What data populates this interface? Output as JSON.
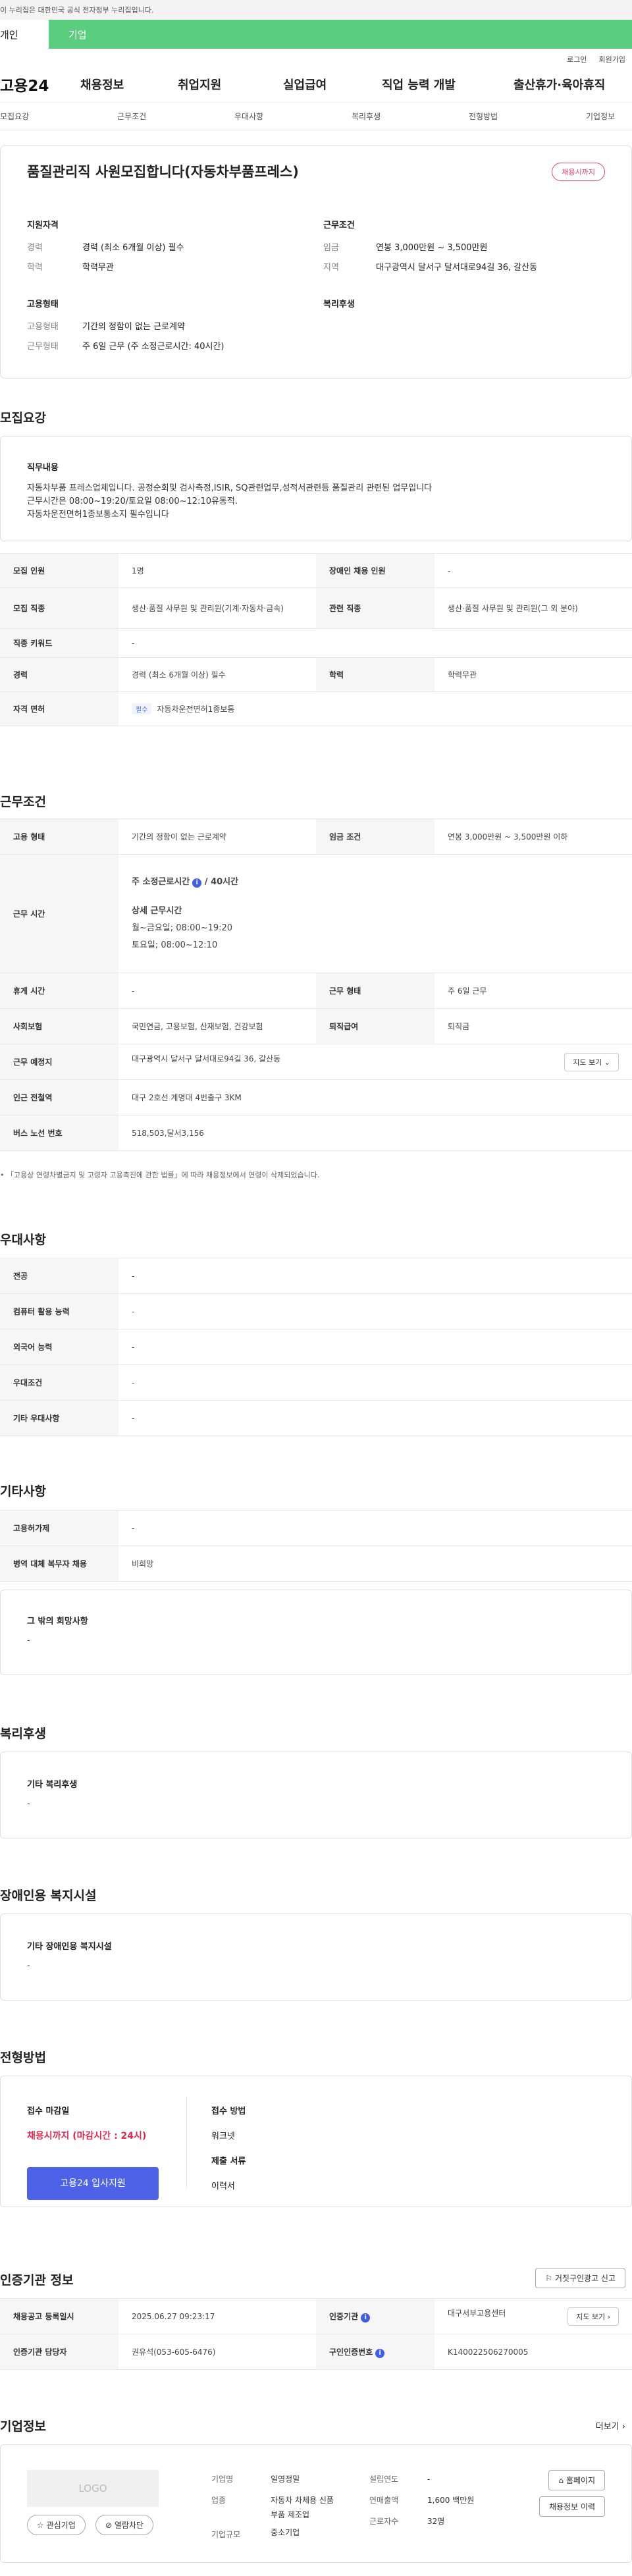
{
  "gov_bar": "이 누리집은 대한민국 공식 전자정부 누리집입니다.",
  "top_tabs": {
    "person": "개인",
    "corp": "기업"
  },
  "util_links": [
    "로그인",
    "회원가입"
  ],
  "logo": "고용24",
  "nav": [
    "채용정보",
    "취업지원",
    "실업급여",
    "직업 능력 개발",
    "출산휴가·육아휴직"
  ],
  "sub_nav": [
    "모집요강",
    "근무조건",
    "우대사항",
    "복리후생",
    "전형방법",
    "기업정보"
  ],
  "job": {
    "title": "품질관리직 사원모집합니다(자동차부품프레스)",
    "badge": "채용시까지",
    "qual_title": "지원자격",
    "career_k": "경력",
    "career_v": "경력 (최소 6개월 이상) 필수",
    "edu_k": "학력",
    "edu_v": "학력무관",
    "emp_title": "고용형태",
    "emp_k": "고용형태",
    "emp_v": "기간의 정함이 없는 근로계약",
    "work_k": "근무형태",
    "work_v": "주 6일 근무 (주 소정근로시간: 40시간)",
    "cond_title": "근무조건",
    "wage_k": "임금",
    "wage_v": "연봉 3,000만원 ~ 3,500만원",
    "area_k": "지역",
    "area_v": "대구광역시 달서구 달서대로94길 36, 갈산동",
    "welfare_title": "복리후생"
  },
  "recruit": {
    "title": "모집요강",
    "duty_h": "직무내용",
    "duty_1": "자동차부품 프레스업체입니다. 공정순회및 검사측정,ISIR, SQ관련업무,성적서관련등 품질관리 관련된 업무입니다",
    "duty_2": "근무시간은 08:00~19:20/토요일 08:00~12:10유동적.",
    "duty_3": "자동차운전면허1종보통소지 필수입니다",
    "rows": {
      "count_k": "모집 인원",
      "count_v": "1명",
      "disabled_k": "장애인 채용 인원",
      "disabled_v": "-",
      "job_k": "모집 직종",
      "job_v": "생산·품질 사무원 및 관리원(기계·자동차·금속)",
      "rel_k": "관련 직종",
      "rel_v": "생산·품질 사무원 및 관리원(그 외 분야)",
      "kw_k": "직종 키워드",
      "kw_v": "-",
      "career_k": "경력",
      "career_v": "경력 (최소 6개월 이상) 필수",
      "edu_k": "학력",
      "edu_v": "학력무관",
      "lic_k": "자격 면허",
      "lic_tag": "필수",
      "lic_v": "자동차운전면허1종보통"
    }
  },
  "work": {
    "title": "근무조건",
    "type_k": "고용 형태",
    "type_v": "기간의 정함이 없는 근로계약",
    "wage_k": "임금 조건",
    "wage_v": "연봉 3,000만원 ~ 3,500만원 이하",
    "hours_k": "근무 시간",
    "hours_main": "주 소정근로시간",
    "hours_val": "40시간",
    "detail_h": "상세 근무시간",
    "detail_1": "월~금요일; 08:00~19:20",
    "detail_2": "토요일; 08:00~12:10",
    "rest_k": "휴게 시간",
    "rest_v": "-",
    "form_k": "근무 형태",
    "form_v": "주 6일 근무",
    "ins_k": "사회보험",
    "ins_v": "국민연금, 고용보험, 산재보험, 건강보험",
    "ret_k": "퇴직급여",
    "ret_v": "퇴직금",
    "place_k": "근무 예정지",
    "place_v": "대구광역시 달서구 달서대로94길 36, 갈산동",
    "map_btn": "지도 보기",
    "subway_k": "인근 전철역",
    "subway_v": "대구 2호선 계명대 4번출구 3KM",
    "bus_k": "버스 노선 번호",
    "bus_v": "518,503,달서3,156",
    "note": "「고용상 연령차별금지 및 고령자 고용촉진에 관한 법률」에 따라 채용정보에서 연령이 삭제되었습니다."
  },
  "pref": {
    "title": "우대사항",
    "major_k": "전공",
    "major_v": "-",
    "pc_k": "컴퓨터 활용 능력",
    "pc_v": "-",
    "lang_k": "외국어 능력",
    "lang_v": "-",
    "cond_k": "우대조건",
    "cond_v": "-",
    "etc_k": "기타 우대사항",
    "etc_v": "-"
  },
  "other": {
    "title": "기타사항",
    "ins_k": "고용허가제",
    "ins_v": "-",
    "mil_k": "병역 대체 복무자 채용",
    "mil_v": "비희망",
    "wish_h": "그 밖의 희망사항",
    "wish_v": "-"
  },
  "welfare": {
    "title": "복리후생",
    "h": "기타 복리후생",
    "v": "-"
  },
  "disabled_fac": {
    "title": "장애인용 복지시설",
    "h": "기타 장애인용 복지시설",
    "v": "-"
  },
  "selection": {
    "title": "전형방법",
    "deadline_h": "접수 마감일",
    "deadline_v": "채용시까지 (마감시간 : 24시)",
    "apply_btn": "고용24 입사지원",
    "method_h": "접수 방법",
    "method_v": "워크넷",
    "docs_h": "제출 서류",
    "docs_v": "이력서"
  },
  "cert": {
    "title": "인증기관 정보",
    "report_btn": "거짓구인광고 신고",
    "reg_k": "채용공고 등록일시",
    "reg_v": "2025.06.27 09:23:17",
    "org_k": "인증기관",
    "org_v": "대구서부고용센터",
    "map_btn": "지도 보기",
    "mgr_k": "인증기관 담당자",
    "mgr_v": "권유석(053-605-6476)",
    "num_k": "구인인증번호",
    "num_v": "K140022506270005"
  },
  "company": {
    "title": "기업정보",
    "more": "더보기",
    "logo_text": "LOGO",
    "fav_btn": "관심기업",
    "block_btn": "열람차단",
    "name_k": "기업명",
    "name_v": "일영정밀",
    "biz_k": "업종",
    "biz_v": "자동차 차체용 신품 부품 제조업",
    "size_k": "기업규모",
    "size_v": "중소기업",
    "year_k": "설립연도",
    "year_v": "-",
    "sales_k": "연매출액",
    "sales_v": "1,600 백만원",
    "emp_k": "근로자수",
    "emp_v": "32명",
    "home_btn": "홈페이지",
    "hist_btn": "채용정보 이력"
  }
}
